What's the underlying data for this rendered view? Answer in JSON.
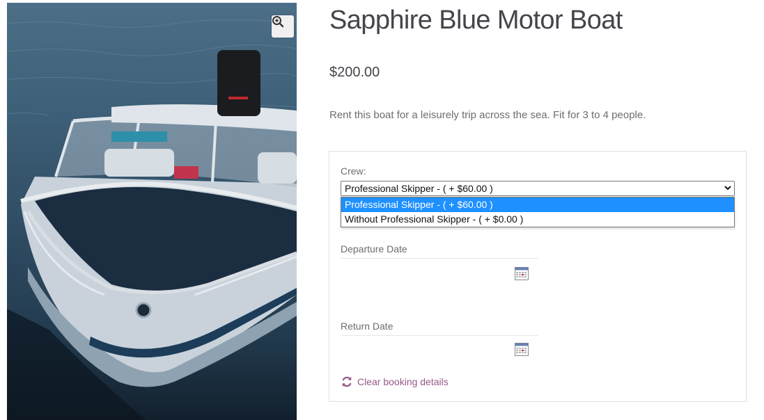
{
  "product": {
    "title": "Sapphire Blue Motor Boat",
    "price": "$200.00",
    "description": "Rent this boat for a leisurely trip across the sea.  Fit for 3 to 4 people."
  },
  "gallery": {
    "zoom_icon": "magnifier-plus-icon",
    "image_subject": "motor boat"
  },
  "booking": {
    "crew_label": "Crew:",
    "crew_selected": "Professional Skipper - ( + $60.00 )",
    "crew_options": [
      "Professional Skipper - ( + $60.00 )",
      "Without Professional Skipper - ( + $0.00 )"
    ],
    "departure_label": "Departure Date",
    "return_label": "Return Date",
    "clear_label": "Clear booking details"
  },
  "colors": {
    "accent": "#96588a",
    "option_highlight": "#1e90ff",
    "text": "#43454b"
  }
}
